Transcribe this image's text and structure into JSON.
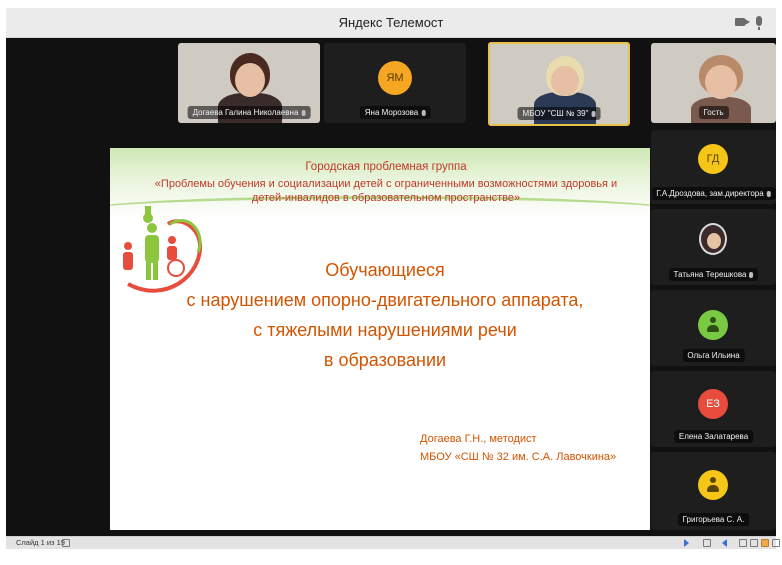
{
  "window": {
    "title": "Яндекс Телемост"
  },
  "participants_top": [
    {
      "name": "Догаева Галина Николаевна",
      "type": "video",
      "active": false
    },
    {
      "name": "Яна Морозова",
      "type": "avatar",
      "initials": "ЯМ",
      "color": "#f5a623",
      "active": false
    },
    {
      "name": "МБОУ \"СШ № 39\"",
      "type": "video",
      "active": true
    },
    {
      "name": "Гость",
      "type": "video",
      "active": false
    }
  ],
  "participants_side": [
    {
      "name": "Г.А.Дроздова, зам.директора",
      "type": "avatar",
      "initials": "ГД",
      "color": "#f5c518"
    },
    {
      "name": "Татьяна Терешкова",
      "type": "photo",
      "initials": ""
    },
    {
      "name": "Ольга Ильина",
      "type": "avatar",
      "initials": "",
      "color": "#7ac943"
    },
    {
      "name": "Елена Залатарева",
      "type": "avatar",
      "initials": "ЕЗ",
      "color": "#e84c3d"
    },
    {
      "name": "Григорьева С. А.",
      "type": "avatar",
      "initials": "",
      "color": "#f5c518"
    }
  ],
  "slide": {
    "group": "Городская проблемная группа",
    "problem": "«Проблемы обучения и социализации детей с ограниченными возможностями здоровья и детей-инвалидов в образовательном пространстве»",
    "main_lines": [
      "Обучающиеся",
      "с нарушением опорно-двигательного аппарата,",
      "с тяжелыми нарушениями речи",
      "в образовании"
    ],
    "author": "Догаева Г.Н., методист",
    "school": "МБОУ «СШ № 32 им. С.А. Лавочкина»"
  },
  "statusbar": {
    "slide_info": "Слайд 1 из 19"
  },
  "colors": {
    "accent_active": "#e6c24a",
    "slide_text": "#d35400",
    "slide_header": "#c0392b"
  }
}
